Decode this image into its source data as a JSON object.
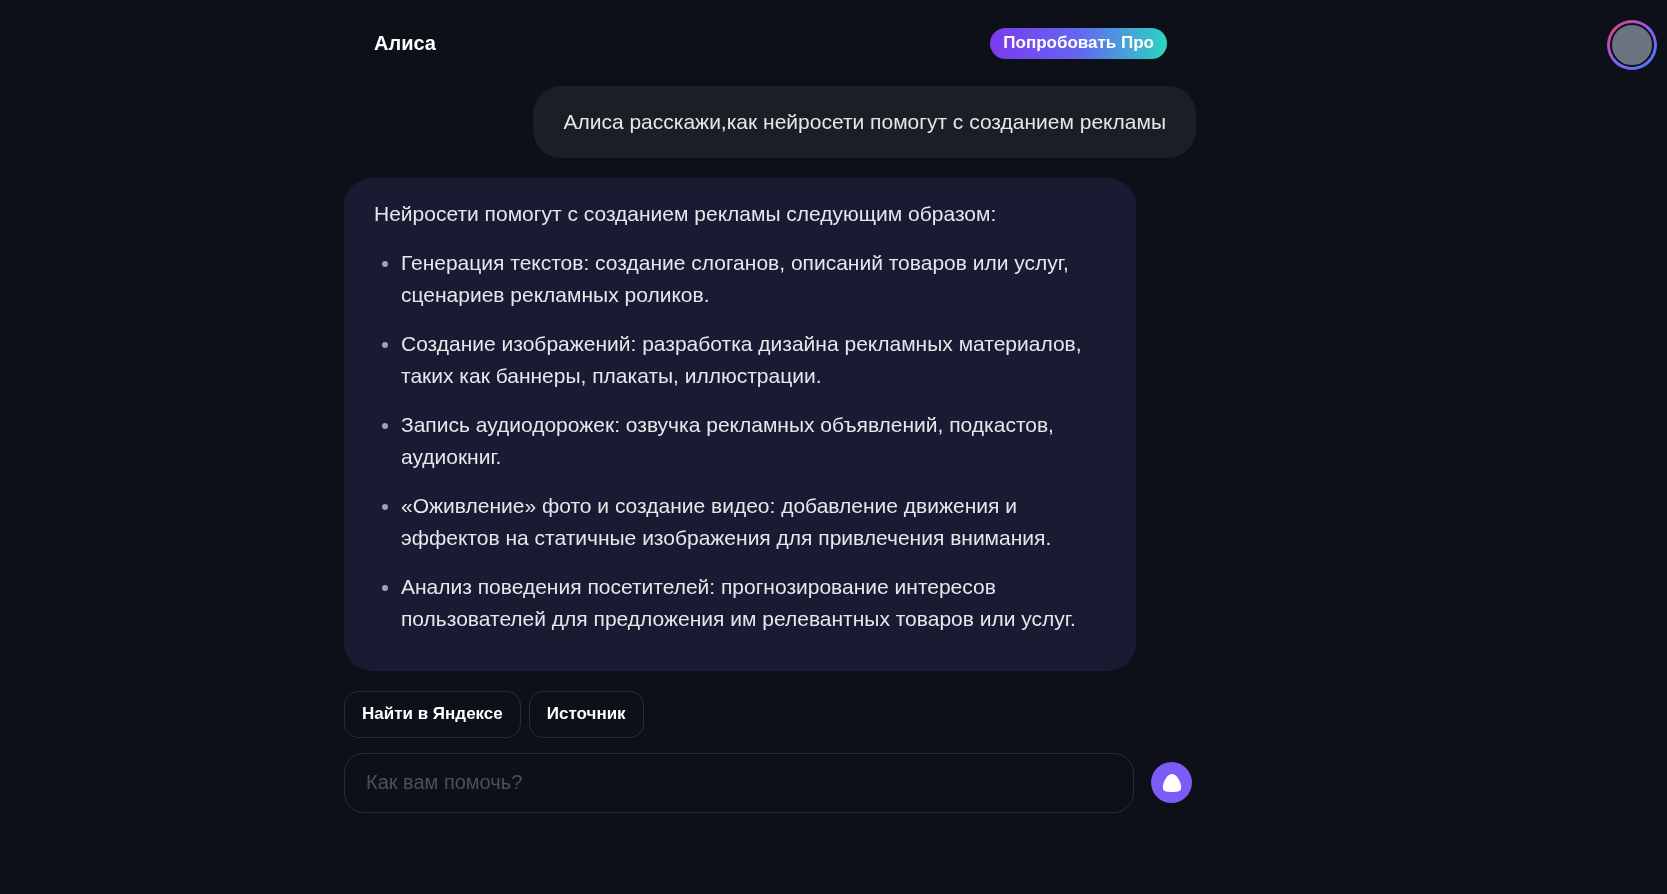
{
  "header": {
    "title": "Алиса",
    "pro_button": "Попробовать Про"
  },
  "user_message": "Алиса расскажи,как нейросети помогут с созданием рекламы",
  "answer": {
    "intro": "Нейросети помогут с созданием рекламы следующим образом:",
    "items": [
      "Генерация текстов: создание слоганов, описаний товаров или услуг, сценариев рекламных роликов.",
      "Создание изображений: разработка дизайна рекламных материалов, таких как баннеры, плакаты, иллюстрации.",
      "Запись аудиодорожек: озвучка рекламных объявлений, подкастов, аудиокниг.",
      "«Оживление» фото и создание видео: добавление движения и эффектов на статичные изображения для привлечения внимания.",
      "Анализ поведения посетителей: прогнозирование интересов пользователей для предложения им релевантных товаров или услуг."
    ]
  },
  "actions": [
    "Найти в Яндексе",
    "Источник"
  ],
  "input": {
    "placeholder": "Как вам помочь?"
  }
}
